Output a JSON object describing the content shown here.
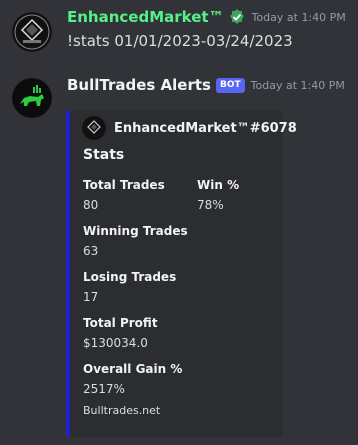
{
  "messages": [
    {
      "username": "EnhancedMarket™",
      "username_color": "#57f287",
      "verified_icon": "verified-check-icon",
      "timestamp": "Today at 1:40 PM",
      "content": "!stats 01/01/2023-03/24/2023"
    },
    {
      "username": "BullTrades Alerts",
      "username_color": "#f2f3f5",
      "bot_tag": "BOT",
      "timestamp": "Today at 1:40 PM",
      "embed": {
        "accent_color": "#1f1fd6",
        "author": "EnhancedMarket™#6078",
        "title": "Stats",
        "fields": [
          {
            "name": "Total Trades",
            "value": "80"
          },
          {
            "name": "Win %",
            "value": "78%"
          },
          {
            "name": "Winning Trades",
            "value": "63"
          },
          {
            "name": "Losing Trades",
            "value": "17"
          },
          {
            "name": "Total Profit",
            "value": "$130034.0"
          },
          {
            "name": "Overall Gain %",
            "value": "2517%"
          }
        ],
        "footer": "Bulltrades.net"
      }
    }
  ]
}
